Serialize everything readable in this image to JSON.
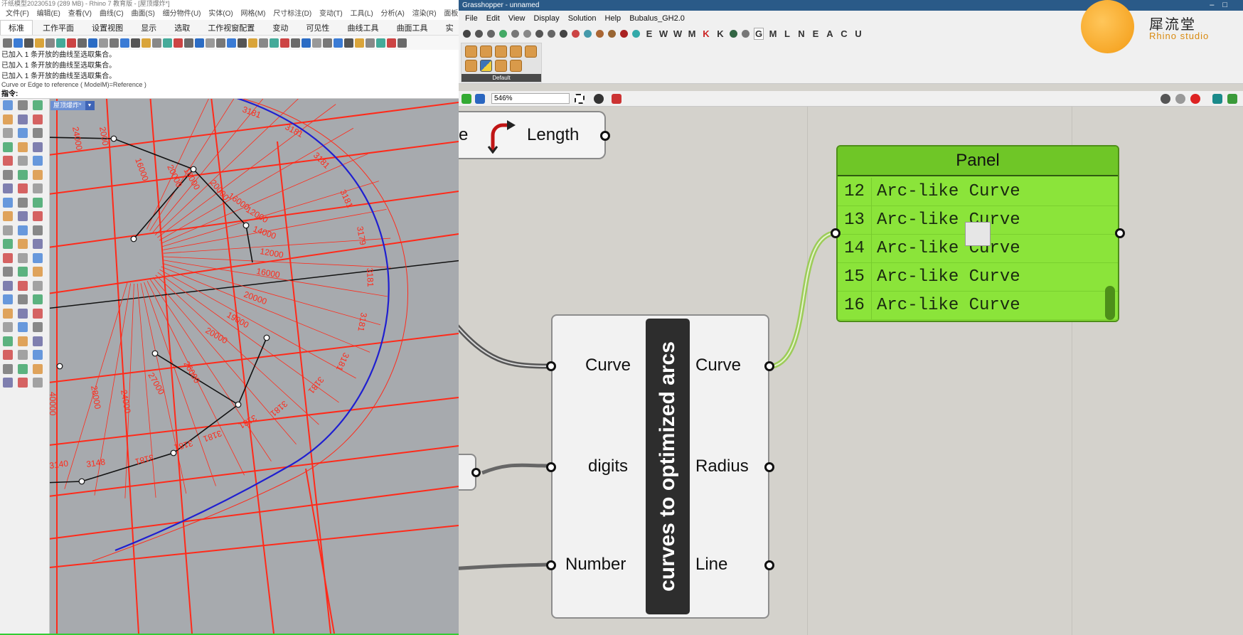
{
  "rhino": {
    "title": "汗纸模型20230519 (289 MB) - Rhino 7 教育版 - [屋顶爆炸*]",
    "menu": [
      "文件(F)",
      "编辑(E)",
      "查看(V)",
      "曲线(C)",
      "曲面(S)",
      "细分物件(U)",
      "实体(O)",
      "网格(M)",
      "尺寸标注(D)",
      "变动(T)",
      "工具(L)",
      "分析(A)",
      "渲染(R)",
      "面板(P)"
    ],
    "tabs": [
      "标准",
      "工作平面",
      "设置视图",
      "显示",
      "选取",
      "工作视窗配置",
      "变动",
      "可见性",
      "曲线工具",
      "曲面工具",
      "实"
    ],
    "command_history": [
      "已加入 1 条开放的曲线至选取集合。",
      "已加入 1 条开放的曲线至选取集合。",
      "已加入 1 条开放的曲线至选取集合。"
    ],
    "command_prompt": "Curve or Edge to reference ( ModelM)=Reference )",
    "command_label": "指令:",
    "viewport_tab": "屋顶爆炸*",
    "viewport_tab_arrow": "▼",
    "dimensions": {
      "arc_labels": [
        "3181",
        "3181",
        "3181",
        "3181",
        "3179",
        "3181",
        "3181",
        "3181",
        "3181",
        "3181",
        "3181",
        "3181",
        "3181",
        "3181",
        "3148",
        "3140"
      ],
      "radial_labels": [
        "16000",
        "20000",
        "16000",
        "20000",
        "16000",
        "12000",
        "14000",
        "12000",
        "16000",
        "20000",
        "19000",
        "20000",
        "26000",
        "27000",
        "24000",
        "28000",
        "40000",
        "24000",
        "2000"
      ]
    }
  },
  "grasshopper": {
    "title": "Grasshopper - unnamed",
    "menu": [
      "File",
      "Edit",
      "View",
      "Display",
      "Solution",
      "Help",
      "Bubalus_GH2.0"
    ],
    "tab_letters": [
      "E",
      "W",
      "W",
      "M",
      "K",
      "K",
      "G",
      "M",
      "L",
      "N",
      "E",
      "A",
      "C",
      "U"
    ],
    "selected_tab_letter": "G",
    "ribbon_group_label": "Default",
    "zoom": "546%",
    "length_component": {
      "input_label": "e",
      "output_label": "Length"
    },
    "main_component": {
      "nickname": "curves to optimized arcs",
      "inputs": [
        "Curve",
        "digits",
        "Number"
      ],
      "outputs": [
        "Curve",
        "Radius",
        "Line"
      ]
    },
    "panel": {
      "title": "Panel",
      "rows": [
        {
          "index": "12",
          "value": "Arc-like Curve"
        },
        {
          "index": "13",
          "value": "Arc-like Curve"
        },
        {
          "index": "14",
          "value": "Arc-like Curve"
        },
        {
          "index": "15",
          "value": "Arc-like Curve"
        },
        {
          "index": "16",
          "value": "Arc-like Curve"
        }
      ],
      "color": "#8be43a"
    }
  },
  "logo": {
    "cn": "犀流堂",
    "en": "Rhino studio"
  },
  "colors": {
    "gh_title": "#2a5a88",
    "viewport_bg": "#a7aaae",
    "dim_red": "#ff2a1a",
    "arc_blue": "#1f1fd0",
    "panel_green": "#8be43a"
  }
}
